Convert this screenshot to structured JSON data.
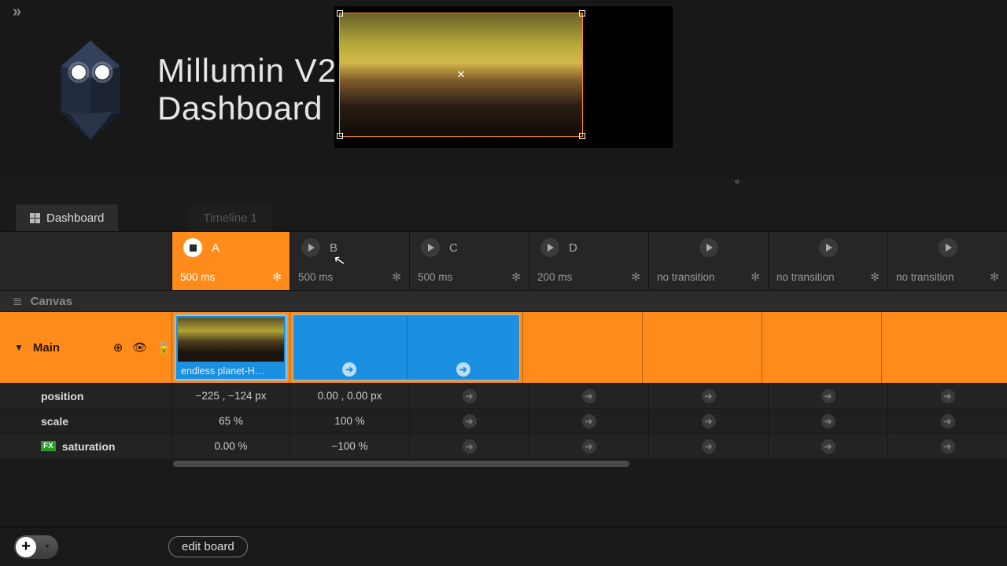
{
  "header": {
    "title_line1": "Millumin V2",
    "title_line2": "Dashboard",
    "expand_icon": "»"
  },
  "tabs": {
    "dashboard": "Dashboard",
    "timeline": "Timeline 1"
  },
  "columns": [
    {
      "label": "A",
      "transition": "500  ms",
      "active": true,
      "playing": true
    },
    {
      "label": "B",
      "transition": "500  ms",
      "active": false
    },
    {
      "label": "C",
      "transition": "500  ms",
      "active": false
    },
    {
      "label": "D",
      "transition": "200  ms",
      "active": false
    },
    {
      "label": "",
      "transition": "no transition",
      "active": false
    },
    {
      "label": "",
      "transition": "no transition",
      "active": false
    },
    {
      "label": "",
      "transition": "no transition",
      "active": false
    }
  ],
  "canvas_label": "Canvas",
  "layer": {
    "name": "Main",
    "clip_label": "endless planet-H…"
  },
  "props": {
    "position": {
      "label": "position",
      "a": "−225 , −124 px",
      "b": "0.00 , 0.00 px"
    },
    "scale": {
      "label": "scale",
      "a": "65 %",
      "b": "100 %"
    },
    "saturation": {
      "label": "saturation",
      "fx": "FX",
      "a": "0.00 %",
      "b": "−100 %"
    }
  },
  "bottom": {
    "edit_board": "edit board"
  },
  "icons": {
    "gear": "✻",
    "arrow_right": "➜",
    "close_x": "✕",
    "eye": "👁",
    "lock": "🔓",
    "target": "⊕",
    "layers": "≣",
    "tri_down": "▼"
  }
}
